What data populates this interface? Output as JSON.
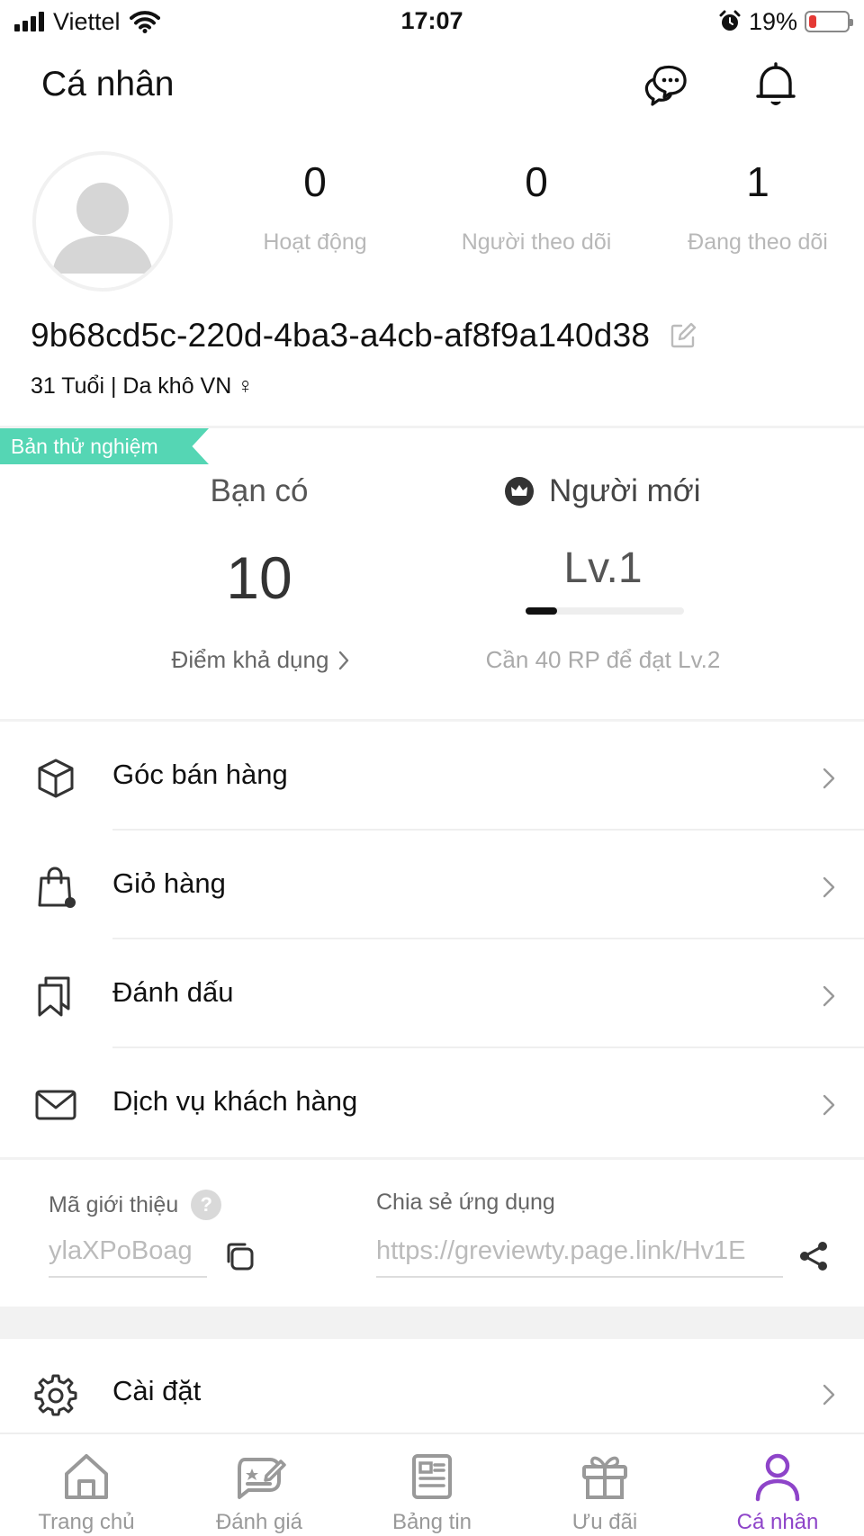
{
  "status_bar": {
    "carrier": "Viettel",
    "time": "17:07",
    "battery": "19%",
    "battery_level": 0.19
  },
  "header": {
    "title": "Cá nhân",
    "chat_icon": "chat-bubbles-icon",
    "bell_icon": "bell-icon"
  },
  "profile": {
    "stats": [
      {
        "value": "0",
        "label": "Hoạt động"
      },
      {
        "value": "0",
        "label": "Người theo dõi"
      },
      {
        "value": "1",
        "label": "Đang theo dõi"
      }
    ],
    "username": "9b68cd5c-220d-4ba3-a4cb-af8f9a140d38",
    "meta": "31 Tuổi | Da khô VN",
    "gender_symbol": "♀"
  },
  "beta_ribbon": "Bản thử nghiệm",
  "points": {
    "label": "Bạn có",
    "value": "10",
    "link": "Điểm khả dụng"
  },
  "level": {
    "title": "Người mới",
    "value": "Lv.1",
    "progress": 0.2,
    "hint": "Cần 40 RP để đạt Lv.2"
  },
  "menu": [
    {
      "label": "Góc bán hàng",
      "icon": "box-icon"
    },
    {
      "label": "Giỏ hàng",
      "icon": "shopping-bag-icon"
    },
    {
      "label": "Đánh dấu",
      "icon": "bookmarks-icon"
    },
    {
      "label": "Dịch vụ khách hàng",
      "icon": "mail-icon"
    }
  ],
  "referral": {
    "code_label": "Mã giới thiệu",
    "code_value": "ylaXPoBoag",
    "share_label": "Chia sẻ ứng dụng",
    "share_link": "https://greviewty.page.link/Hv1E"
  },
  "settings": {
    "label": "Cài đặt",
    "icon": "gear-icon"
  },
  "bottom_nav": [
    {
      "label": "Trang chủ",
      "icon": "home-icon"
    },
    {
      "label": "Đánh giá",
      "icon": "review-icon"
    },
    {
      "label": "Bảng tin",
      "icon": "news-icon"
    },
    {
      "label": "Ưu đãi",
      "icon": "gift-icon"
    },
    {
      "label": "Cá nhân",
      "icon": "person-icon",
      "active": true
    }
  ],
  "colors": {
    "accent": "#8e44c9",
    "ribbon": "#55d6b4",
    "battery_low": "#e53935"
  }
}
